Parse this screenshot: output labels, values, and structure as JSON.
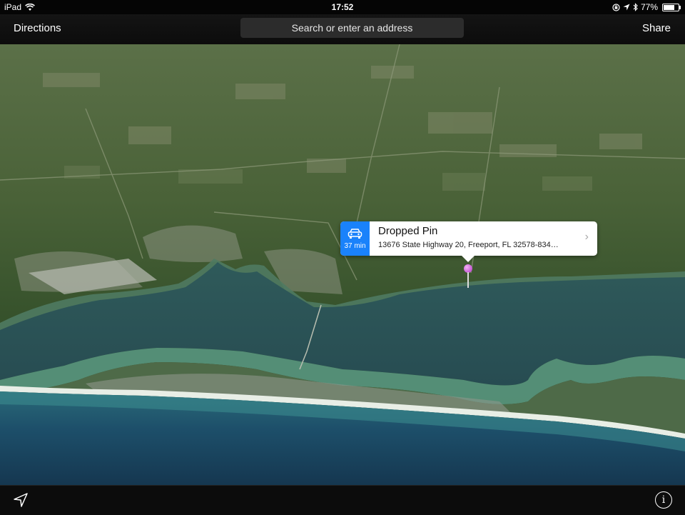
{
  "status_bar": {
    "device": "iPad",
    "time": "17:52",
    "battery": "77%",
    "battery_level": 0.77,
    "icons": [
      "wifi-icon",
      "rotation-lock-icon",
      "location-arrow-icon",
      "bluetooth-icon",
      "battery-icon"
    ]
  },
  "nav": {
    "directions_label": "Directions",
    "search_placeholder": "Search or enter an address",
    "share_label": "Share"
  },
  "callout": {
    "drive_time": "37 min",
    "title": "Dropped Pin",
    "address": "13676 State Highway 20, Freeport, FL  32578-834…",
    "pin_color": "#c040d0",
    "accent": "#1a82fb"
  },
  "bottom_bar": {
    "icons": [
      "location-arrow-icon",
      "info-icon"
    ]
  }
}
